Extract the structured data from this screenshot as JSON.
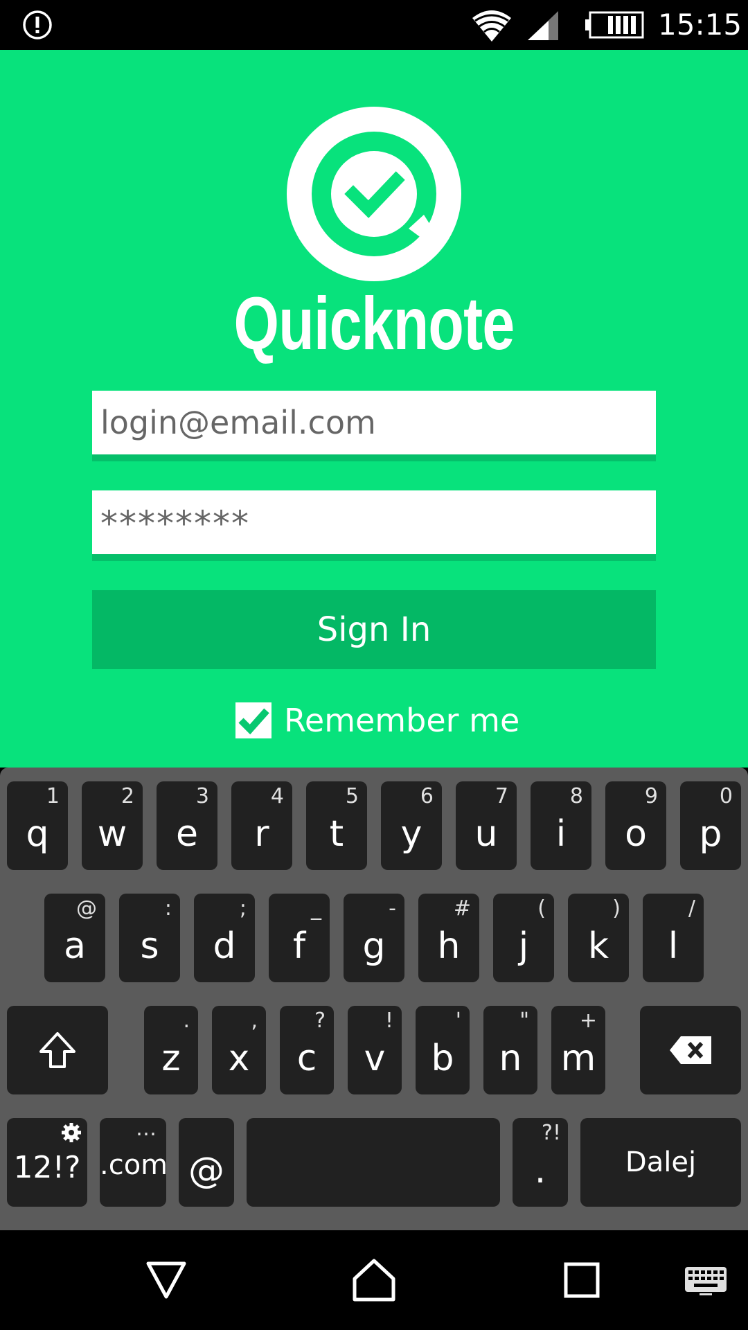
{
  "status_bar": {
    "time": "15:15",
    "icons": [
      "alert-icon",
      "wifi-icon",
      "signal-icon",
      "battery-icon"
    ]
  },
  "app": {
    "title": "Quicknote",
    "logo": "quicknote-logo",
    "email_value": "login@email.com",
    "password_value": "********",
    "sign_in_label": "Sign In",
    "remember_label": "Remember me",
    "remember_checked": true,
    "colors": {
      "background": "#08e27c",
      "button": "#04b865",
      "underline": "#06bf6a"
    }
  },
  "keyboard": {
    "row1": [
      {
        "key": "q",
        "hint": "1"
      },
      {
        "key": "w",
        "hint": "2"
      },
      {
        "key": "e",
        "hint": "3"
      },
      {
        "key": "r",
        "hint": "4"
      },
      {
        "key": "t",
        "hint": "5"
      },
      {
        "key": "y",
        "hint": "6"
      },
      {
        "key": "u",
        "hint": "7"
      },
      {
        "key": "i",
        "hint": "8"
      },
      {
        "key": "o",
        "hint": "9"
      },
      {
        "key": "p",
        "hint": "0"
      }
    ],
    "row2": [
      {
        "key": "a",
        "hint": "@"
      },
      {
        "key": "s",
        "hint": ":"
      },
      {
        "key": "d",
        "hint": ";"
      },
      {
        "key": "f",
        "hint": "_"
      },
      {
        "key": "g",
        "hint": "-"
      },
      {
        "key": "h",
        "hint": "#"
      },
      {
        "key": "j",
        "hint": "("
      },
      {
        "key": "k",
        "hint": ")"
      },
      {
        "key": "l",
        "hint": "/"
      }
    ],
    "row3": [
      {
        "key": "z",
        "hint": "."
      },
      {
        "key": "x",
        "hint": ","
      },
      {
        "key": "c",
        "hint": "?"
      },
      {
        "key": "v",
        "hint": "!"
      },
      {
        "key": "b",
        "hint": "'"
      },
      {
        "key": "n",
        "hint": "\""
      },
      {
        "key": "m",
        "hint": "+"
      }
    ],
    "symbols_key": "12!?",
    "dotcom_key": ".com",
    "dotcom_hint": "…",
    "at_key": "@",
    "period_key": ".",
    "period_hint": "?!",
    "action_key": "Dalej",
    "icons": [
      "shift-icon",
      "backspace-icon",
      "settings-icon"
    ]
  },
  "nav_bar": {
    "icons": [
      "back-icon",
      "home-icon",
      "recents-icon",
      "keyboard-switch-icon"
    ]
  }
}
